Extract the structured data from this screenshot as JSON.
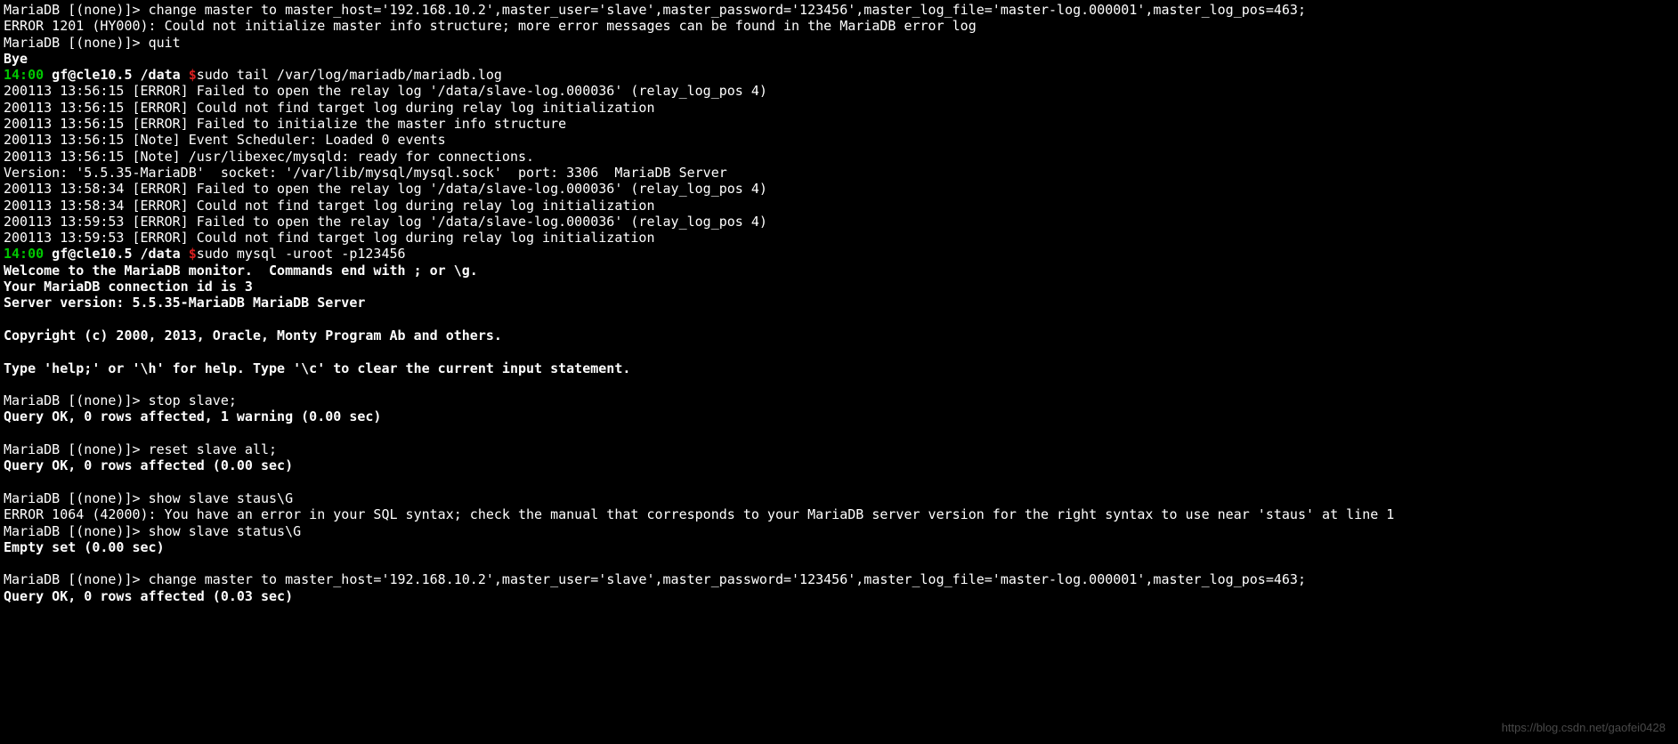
{
  "mprompt": "MariaDB [(none)]> ",
  "cmd_change_master": "change master to master_host='192.168.10.2',master_user='slave',master_password='123456',master_log_file='master-log.000001',master_log_pos=463;",
  "err_1201": "ERROR 1201 (HY000): Could not initialize master info structure; more error messages can be found in the MariaDB error log",
  "cmd_quit": "quit",
  "bye": "Bye",
  "shell": {
    "time": "14:00",
    "userhost": " gf@cle10.5 /data ",
    "dollar": "$"
  },
  "cmd_tail": "sudo tail /var/log/mariadb/mariadb.log",
  "log": {
    "l1": "200113 13:56:15 [ERROR] Failed to open the relay log '/data/slave-log.000036' (relay_log_pos 4)",
    "l2": "200113 13:56:15 [ERROR] Could not find target log during relay log initialization",
    "l3": "200113 13:56:15 [ERROR] Failed to initialize the master info structure",
    "l4": "200113 13:56:15 [Note] Event Scheduler: Loaded 0 events",
    "l5": "200113 13:56:15 [Note] /usr/libexec/mysqld: ready for connections.",
    "l6": "Version: '5.5.35-MariaDB'  socket: '/var/lib/mysql/mysql.sock'  port: 3306  MariaDB Server",
    "l7": "200113 13:58:34 [ERROR] Failed to open the relay log '/data/slave-log.000036' (relay_log_pos 4)",
    "l8": "200113 13:58:34 [ERROR] Could not find target log during relay log initialization",
    "l9": "200113 13:59:53 [ERROR] Failed to open the relay log '/data/slave-log.000036' (relay_log_pos 4)",
    "l10": "200113 13:59:53 [ERROR] Could not find target log during relay log initialization"
  },
  "cmd_mysql": "sudo mysql -uroot -p123456",
  "banner": {
    "b1": "Welcome to the MariaDB monitor.  Commands end with ; or \\g.",
    "b2": "Your MariaDB connection id is 3",
    "b3": "Server version: 5.5.35-MariaDB MariaDB Server",
    "b4": "Copyright (c) 2000, 2013, Oracle, Monty Program Ab and others.",
    "b5": "Type 'help;' or '\\h' for help. Type '\\c' to clear the current input statement."
  },
  "cmd_stop_slave": "stop slave;",
  "res_stop_slave": "Query OK, 0 rows affected, 1 warning (0.00 sec)",
  "cmd_reset_slave": "reset slave all;",
  "res_reset_slave": "Query OK, 0 rows affected (0.00 sec)",
  "cmd_show_staus": "show slave staus\\G",
  "err_1064": "ERROR 1064 (42000): You have an error in your SQL syntax; check the manual that corresponds to your MariaDB server version for the right syntax to use near 'staus' at line 1",
  "cmd_show_status": "show slave status\\G",
  "res_empty": "Empty set (0.00 sec)",
  "res_change_master": "Query OK, 0 rows affected (0.03 sec)",
  "watermark": "https://blog.csdn.net/gaofei0428"
}
